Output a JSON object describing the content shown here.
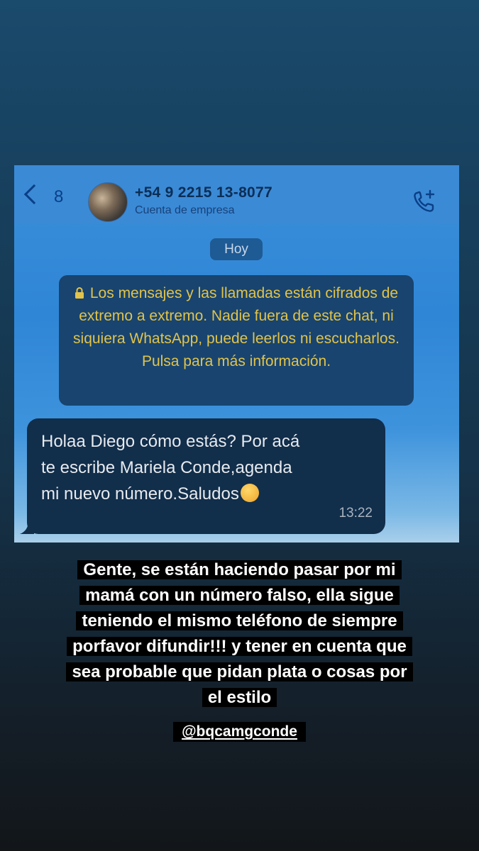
{
  "chat": {
    "back_count": "8",
    "contact_name": "+54 9 2215 13-8077",
    "contact_subtitle": "Cuenta de empresa",
    "date_chip": "Hoy",
    "encryption_notice": "Los mensajes y las llamadas están cifrados de extremo a extremo. Nadie fuera de este chat, ni siquiera WhatsApp, puede leerlos ni escucharlos. Pulsa para más información.",
    "message": {
      "line1": "Holaa Diego cómo estás? Por acá",
      "line2": "te escribe Mariela Conde,agenda",
      "line3": "mi nuevo número.Saludos",
      "emoji": "smiling-face-with-open-hands",
      "time": "13:22"
    },
    "colors": {
      "header_text": "#0b2e55",
      "notice_text": "#e2c34a",
      "bubble": "#112e4b"
    },
    "icons": [
      "chevron-left-icon",
      "add-call-icon",
      "lock-icon"
    ]
  },
  "story": {
    "caption": "Gente, se están haciendo pasar por mi mamá con un número falso, ella sigue teniendo el mismo teléfono de siempre porfavor difundir!!! y tener en cuenta que sea probable que pidan plata o cosas por el estilo",
    "mention": "@bqcamgconde"
  }
}
